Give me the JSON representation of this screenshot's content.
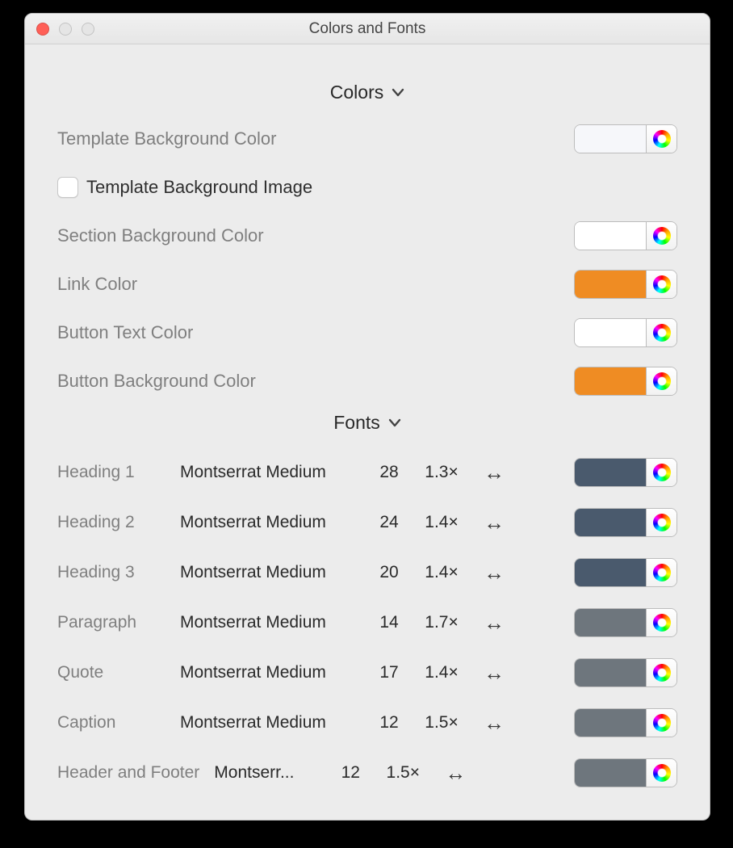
{
  "window": {
    "title": "Colors and Fonts"
  },
  "sections": {
    "colors_header": "Colors",
    "fonts_header": "Fonts"
  },
  "colors": {
    "template_bg": {
      "label": "Template Background Color",
      "value": "#f6f7fa"
    },
    "template_image": {
      "label": "Template Background Image",
      "checked": false
    },
    "section_bg": {
      "label": "Section Background Color",
      "value": "#ffffff"
    },
    "link": {
      "label": "Link Color",
      "value": "#ef8c23"
    },
    "button_text": {
      "label": "Button Text Color",
      "value": "#ffffff"
    },
    "button_bg": {
      "label": "Button Background Color",
      "value": "#ef8c23"
    }
  },
  "fonts": [
    {
      "name": "Heading 1",
      "face": "Montserrat Medium",
      "size": "28",
      "line": "1.3×",
      "arrow": "↔",
      "color": "#4a5a6d"
    },
    {
      "name": "Heading 2",
      "face": "Montserrat Medium",
      "size": "24",
      "line": "1.4×",
      "arrow": "↔",
      "color": "#4a5a6d"
    },
    {
      "name": "Heading 3",
      "face": "Montserrat Medium",
      "size": "20",
      "line": "1.4×",
      "arrow": "↔",
      "color": "#4a5a6d"
    },
    {
      "name": "Paragraph",
      "face": "Montserrat Medium",
      "size": "14",
      "line": "1.7×",
      "arrow": "↔",
      "color": "#6e767d"
    },
    {
      "name": "Quote",
      "face": "Montserrat Medium",
      "size": "17",
      "line": "1.4×",
      "arrow": "↔",
      "color": "#6e767d"
    },
    {
      "name": "Caption",
      "face": "Montserrat Medium",
      "size": "12",
      "line": "1.5×",
      "arrow": "↔",
      "color": "#6e767d"
    },
    {
      "name": "Header and Footer",
      "face": "Montserr...",
      "size": "12",
      "line": "1.5×",
      "arrow": "↔",
      "color": "#6e767d"
    }
  ]
}
